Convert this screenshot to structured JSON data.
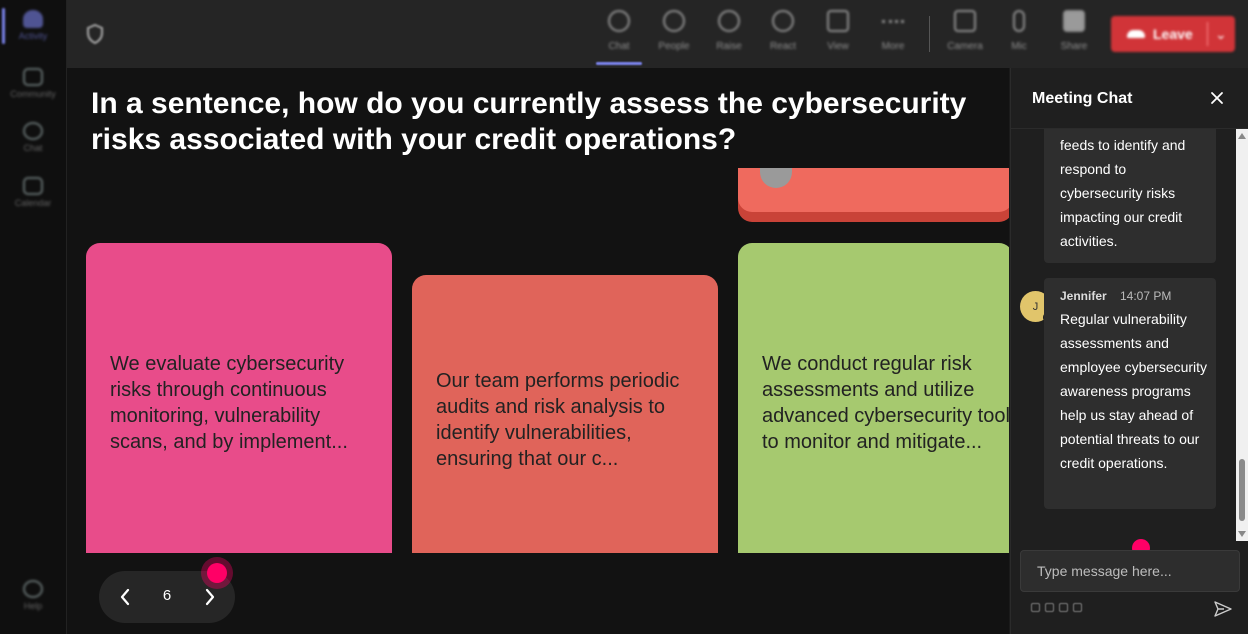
{
  "rail": {
    "items": [
      {
        "label": "Activity",
        "icon": "bell-icon",
        "active": true
      },
      {
        "label": "Community",
        "icon": "community-icon"
      },
      {
        "label": "Chat",
        "icon": "chat-icon"
      },
      {
        "label": "Calendar",
        "icon": "calendar-icon"
      }
    ],
    "help": {
      "label": "Help",
      "icon": "help-icon"
    }
  },
  "toolbar": {
    "buttons": [
      {
        "label": "Chat",
        "icon": "chat-icon",
        "active": true
      },
      {
        "label": "People",
        "icon": "people-icon"
      },
      {
        "label": "Raise",
        "icon": "hand-icon"
      },
      {
        "label": "React",
        "icon": "smile-icon"
      },
      {
        "label": "View",
        "icon": "grid-icon"
      },
      {
        "label": "More",
        "icon": "more-icon"
      },
      {
        "label": "Camera",
        "icon": "camera-off-icon"
      },
      {
        "label": "Mic",
        "icon": "mic-icon"
      },
      {
        "label": "Share",
        "icon": "share-icon"
      }
    ],
    "leave_label": "Leave",
    "leave_color": "#d13438"
  },
  "stage": {
    "question": "In a sentence, how do you currently assess the cybersecurity risks associated with your credit operations?",
    "cards": [
      {
        "text": "We evaluate cybersecurity risks through continuous monitoring, vulnerability scans, and by implement...",
        "color": "#e84c8a"
      },
      {
        "text": "Our team performs periodic audits and risk analysis to identify vulnerabilities, ensuring that our c...",
        "color": "#e0645a"
      },
      {
        "lines": [
          "We conduct regular risk",
          "assessments and utilize",
          "advanced cybersecurity tools",
          "to monitor and mitigate..."
        ],
        "color": "#a6c96f"
      }
    ],
    "page_number": "6"
  },
  "chat": {
    "title": "Meeting Chat",
    "messages": [
      {
        "text": "feeds to identify and respond to cybersecurity risks impacting our credit activities."
      },
      {
        "sender": "Jennifer",
        "initial": "J",
        "time": "14:07 PM",
        "text": "Regular vulnerability assessments and employee cybersecurity awareness programs help us stay ahead of potential threats to our credit operations."
      }
    ],
    "input_placeholder": "Type message here..."
  },
  "colors": {
    "accent": "#7b83eb",
    "pointer": "#ff0066"
  }
}
